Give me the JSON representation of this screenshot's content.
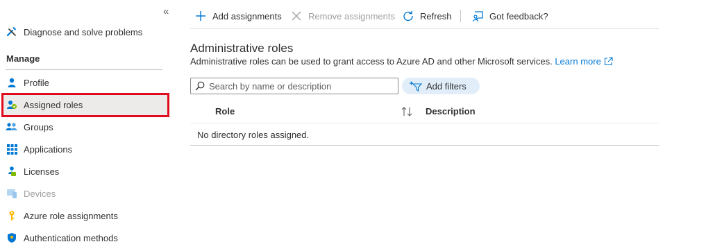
{
  "sidebar": {
    "collapse_glyph": "«",
    "top_item": {
      "label": "Diagnose and solve problems",
      "icon": "wrench-icon"
    },
    "section_header": "Manage",
    "items": [
      {
        "label": "Profile",
        "icon": "person-icon"
      },
      {
        "label": "Assigned roles",
        "icon": "assigned-roles-icon",
        "selected": true
      },
      {
        "label": "Groups",
        "icon": "groups-icon"
      },
      {
        "label": "Applications",
        "icon": "applications-grid-icon"
      },
      {
        "label": "Licenses",
        "icon": "licenses-icon"
      },
      {
        "label": "Devices",
        "icon": "devices-icon",
        "disabled": true
      },
      {
        "label": "Azure role assignments",
        "icon": "key-icon"
      },
      {
        "label": "Authentication methods",
        "icon": "shield-icon"
      }
    ]
  },
  "toolbar": {
    "add_label": "Add assignments",
    "remove_label": "Remove assignments",
    "refresh_label": "Refresh",
    "feedback_label": "Got feedback?"
  },
  "main": {
    "title": "Administrative roles",
    "description": "Administrative roles can be used to grant access to Azure AD and other Microsoft services.",
    "learn_more": "Learn more",
    "search_placeholder": "Search by name or description",
    "filter_label": "Add filters",
    "columns": [
      "Role",
      "Description"
    ],
    "empty_message": "No directory roles assigned."
  },
  "colors": {
    "accent": "#0078d4",
    "selection_outline": "#e00b1c",
    "selected_bg": "#edebe9",
    "filter_pill_bg": "#e1eefa"
  }
}
